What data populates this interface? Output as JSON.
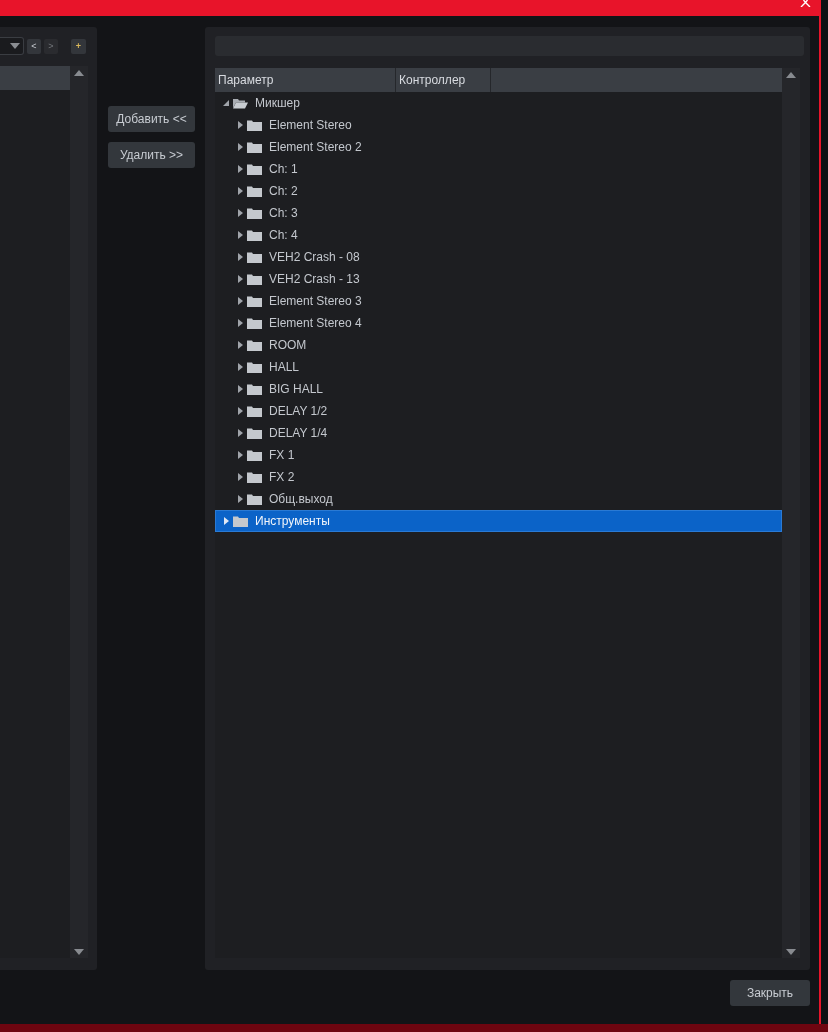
{
  "left_panel": {
    "nav_buttons": [
      {
        "label": "<",
        "disabled": false
      },
      {
        "label": ">",
        "disabled": true
      }
    ],
    "add_button": "+"
  },
  "transfer_buttons": [
    "Добавить <<",
    "Удалить >>"
  ],
  "right_panel": {
    "columns": [
      "Параметр",
      "Контроллер"
    ],
    "tree": [
      {
        "label": "Микшер",
        "expanded": true,
        "selected": false,
        "children": [
          {
            "label": "Element Stereo",
            "expanded": false,
            "selected": false
          },
          {
            "label": "Element Stereo 2",
            "expanded": false,
            "selected": false
          },
          {
            "label": "Ch: 1",
            "expanded": false,
            "selected": false
          },
          {
            "label": "Ch: 2",
            "expanded": false,
            "selected": false
          },
          {
            "label": "Ch: 3",
            "expanded": false,
            "selected": false
          },
          {
            "label": "Ch: 4",
            "expanded": false,
            "selected": false
          },
          {
            "label": "VEH2 Crash - 08",
            "expanded": false,
            "selected": false
          },
          {
            "label": "VEH2 Crash - 13",
            "expanded": false,
            "selected": false
          },
          {
            "label": "Element Stereo 3",
            "expanded": false,
            "selected": false
          },
          {
            "label": "Element Stereo 4",
            "expanded": false,
            "selected": false
          },
          {
            "label": "ROOM",
            "expanded": false,
            "selected": false
          },
          {
            "label": "HALL",
            "expanded": false,
            "selected": false
          },
          {
            "label": "BIG HALL",
            "expanded": false,
            "selected": false
          },
          {
            "label": "DELAY 1/2",
            "expanded": false,
            "selected": false
          },
          {
            "label": "DELAY 1/4",
            "expanded": false,
            "selected": false
          },
          {
            "label": "FX 1",
            "expanded": false,
            "selected": false
          },
          {
            "label": "FX 2",
            "expanded": false,
            "selected": false
          },
          {
            "label": "Общ.выход",
            "expanded": false,
            "selected": false
          }
        ]
      },
      {
        "label": "Инструменты",
        "expanded": false,
        "selected": true
      }
    ]
  },
  "close_button": "Закрыть"
}
